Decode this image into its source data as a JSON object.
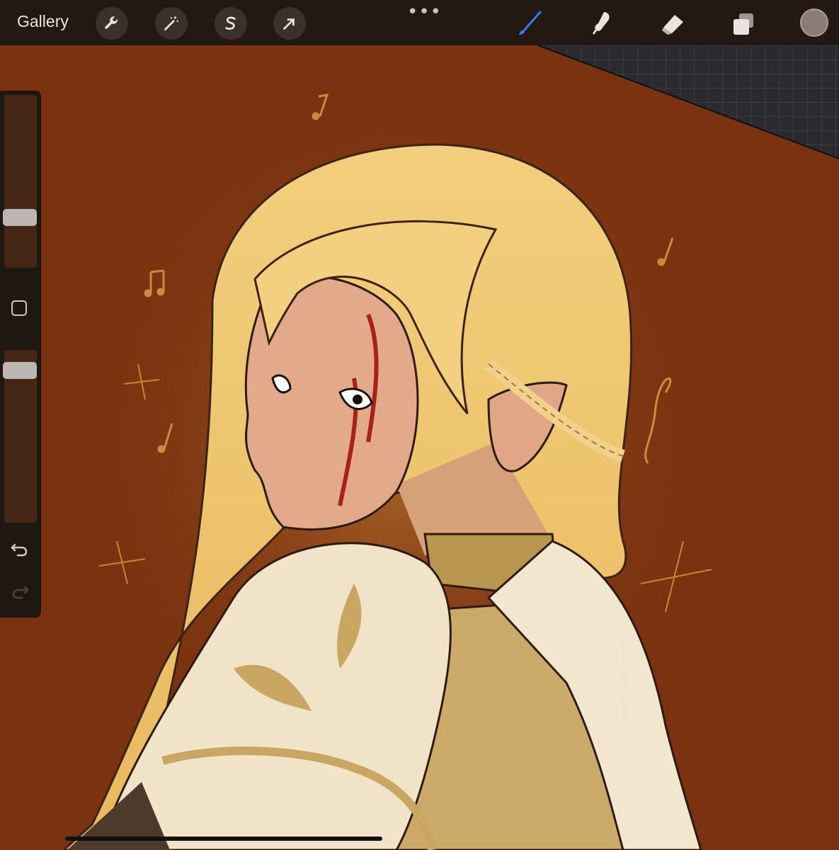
{
  "toolbar": {
    "gallery_label": "Gallery",
    "more_label": "•••",
    "left_tools": [
      "wrench-icon",
      "magic-wand-icon",
      "selection-s-icon",
      "move-arrow-icon"
    ],
    "right_tools": [
      "brush-icon",
      "smudge-icon",
      "eraser-icon",
      "layers-icon"
    ],
    "active_tool": "brush-icon",
    "active_color": "#8c7b76",
    "accent_color": "#2f7df6"
  },
  "sidebar": {
    "brush_size_level": 0.7,
    "opacity_level": 0.1,
    "controls": [
      "brush-size-slider",
      "modify-button",
      "opacity-slider",
      "undo-icon",
      "redo-icon"
    ]
  },
  "canvas": {
    "background_color": "#7a3210",
    "watermark": "@songandsea"
  }
}
